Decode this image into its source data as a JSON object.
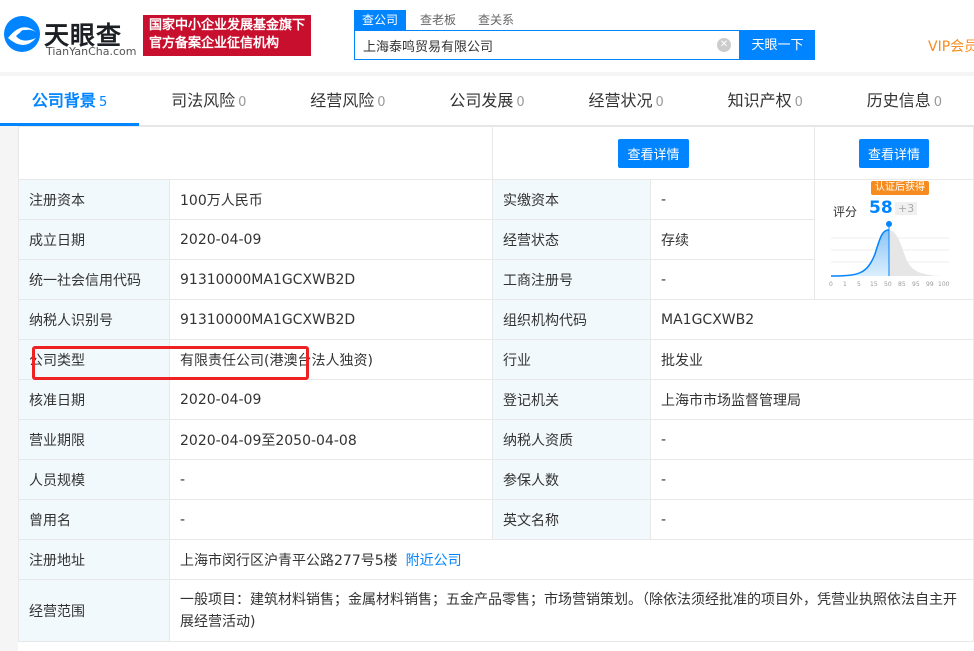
{
  "header": {
    "logo_cn": "天眼查",
    "logo_en": "TianYanCha.com",
    "badge_line1": "国家中小企业发展基金旗下",
    "badge_line2": "官方备案企业征信机构",
    "search_tabs": [
      "查公司",
      "查老板",
      "查关系"
    ],
    "search_value": "上海泰鸣贸易有限公司",
    "search_button": "天眼一下",
    "vip": "VIP会员"
  },
  "nav": [
    {
      "label": "公司背景",
      "count": "5"
    },
    {
      "label": "司法风险",
      "count": "0"
    },
    {
      "label": "经营风险",
      "count": "0"
    },
    {
      "label": "公司发展",
      "count": "0"
    },
    {
      "label": "经营状况",
      "count": "0"
    },
    {
      "label": "知识产权",
      "count": "0"
    },
    {
      "label": "历史信息",
      "count": "0"
    }
  ],
  "detail_button": "查看详情",
  "score": {
    "tag": "认证后获得",
    "label": "评分",
    "value": "58",
    "plus": "+3",
    "axis": [
      "0",
      "1",
      "5",
      "15",
      "50",
      "85",
      "95",
      "99",
      "100"
    ]
  },
  "rows": {
    "r1": {
      "l1": "注册资本",
      "v1": "100万人民币",
      "l2": "实缴资本",
      "v2": "-"
    },
    "r2": {
      "l1": "成立日期",
      "v1": "2020-04-09",
      "l2": "经营状态",
      "v2": "存续"
    },
    "r3": {
      "l1": "统一社会信用代码",
      "v1": "91310000MA1GCXWB2D",
      "l2": "工商注册号",
      "v2": "-"
    },
    "r4": {
      "l1": "纳税人识别号",
      "v1": "91310000MA1GCXWB2D",
      "l2": "组织机构代码",
      "v2": "MA1GCXWB2"
    },
    "r5": {
      "l1": "公司类型",
      "v1": "有限责任公司(港澳台法人独资)",
      "l2": "行业",
      "v2": "批发业"
    },
    "r6": {
      "l1": "核准日期",
      "v1": "2020-04-09",
      "l2": "登记机关",
      "v2": "上海市市场监督管理局"
    },
    "r7": {
      "l1": "营业期限",
      "v1": "2020-04-09至2050-04-08",
      "l2": "纳税人资质",
      "v2": "-"
    },
    "r8": {
      "l1": "人员规模",
      "v1": "-",
      "l2": "参保人数",
      "v2": "-"
    },
    "r9": {
      "l1": "曾用名",
      "v1": "-",
      "l2": "英文名称",
      "v2": "-"
    },
    "r10": {
      "l1": "注册地址",
      "v1": "上海市闵行区沪青平公路277号5楼",
      "link": "附近公司"
    },
    "r11": {
      "l1": "经营范围",
      "v1": "一般项目：建筑材料销售；金属材料销售；五金产品零售；市场营销策划。（除依法须经批准的项目外，凭营业执照依法自主开展经营活动)"
    }
  },
  "colors": {
    "brand": "#0084ff",
    "badge": "#c8102e",
    "vip": "#f68c1f",
    "highlight": "#e22222"
  }
}
